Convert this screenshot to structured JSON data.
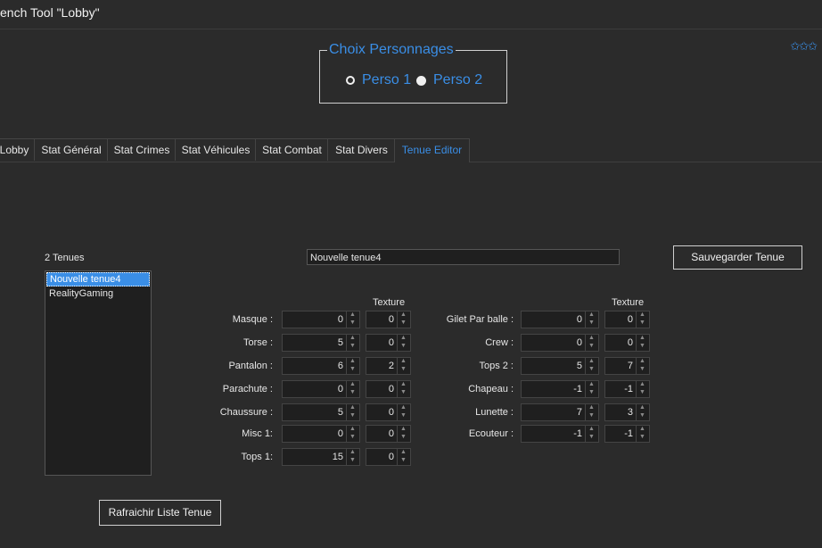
{
  "window": {
    "title": "ench Tool \"Lobby\"",
    "stars": "✩✩✩"
  },
  "choix": {
    "legend": "Choix Personnages",
    "options": [
      {
        "label": "Perso 1",
        "selected": false
      },
      {
        "label": "Perso 2",
        "selected": true
      }
    ]
  },
  "tabs": [
    {
      "label": "Lobby",
      "active": false
    },
    {
      "label": "Stat Général",
      "active": false
    },
    {
      "label": "Stat Crimes",
      "active": false
    },
    {
      "label": "Stat Véhicules",
      "active": false
    },
    {
      "label": "Stat Combat",
      "active": false
    },
    {
      "label": "Stat Divers",
      "active": false
    },
    {
      "label": "Tenue Editor",
      "active": true
    }
  ],
  "tenues": {
    "count_label": "2 Tenues",
    "items": [
      {
        "label": "Nouvelle tenue4",
        "selected": true
      },
      {
        "label": "RealityGaming",
        "selected": false
      }
    ],
    "name_value": "Nouvelle tenue4",
    "save_label": "Sauvegarder Tenue",
    "refresh_label": "Rafraichir Liste Tenue"
  },
  "texture_header": "Texture",
  "left_fields": [
    {
      "label": "Masque :",
      "value": "0",
      "texture": "0"
    },
    {
      "label": "Torse :",
      "value": "5",
      "texture": "0"
    },
    {
      "label": "Pantalon :",
      "value": "6",
      "texture": "2"
    },
    {
      "label": "Parachute :",
      "value": "0",
      "texture": "0"
    },
    {
      "label": "Chaussure :",
      "value": "5",
      "texture": "0"
    },
    {
      "label": "Misc 1:",
      "value": "0",
      "texture": "0"
    },
    {
      "label": "Tops 1:",
      "value": "15",
      "texture": "0"
    }
  ],
  "right_fields": [
    {
      "label": "Gilet Par balle :",
      "value": "0",
      "texture": "0"
    },
    {
      "label": "Crew :",
      "value": "0",
      "texture": "0"
    },
    {
      "label": "Tops 2 :",
      "value": "5",
      "texture": "7"
    },
    {
      "label": "Chapeau :",
      "value": "-1",
      "texture": "-1"
    },
    {
      "label": "Lunette :",
      "value": "7",
      "texture": "3"
    },
    {
      "label": "Ecouteur :",
      "value": "-1",
      "texture": "-1"
    }
  ],
  "colors": {
    "accent": "#3a8ee6",
    "background": "#2b2b2b",
    "field": "#1f1f1f"
  }
}
